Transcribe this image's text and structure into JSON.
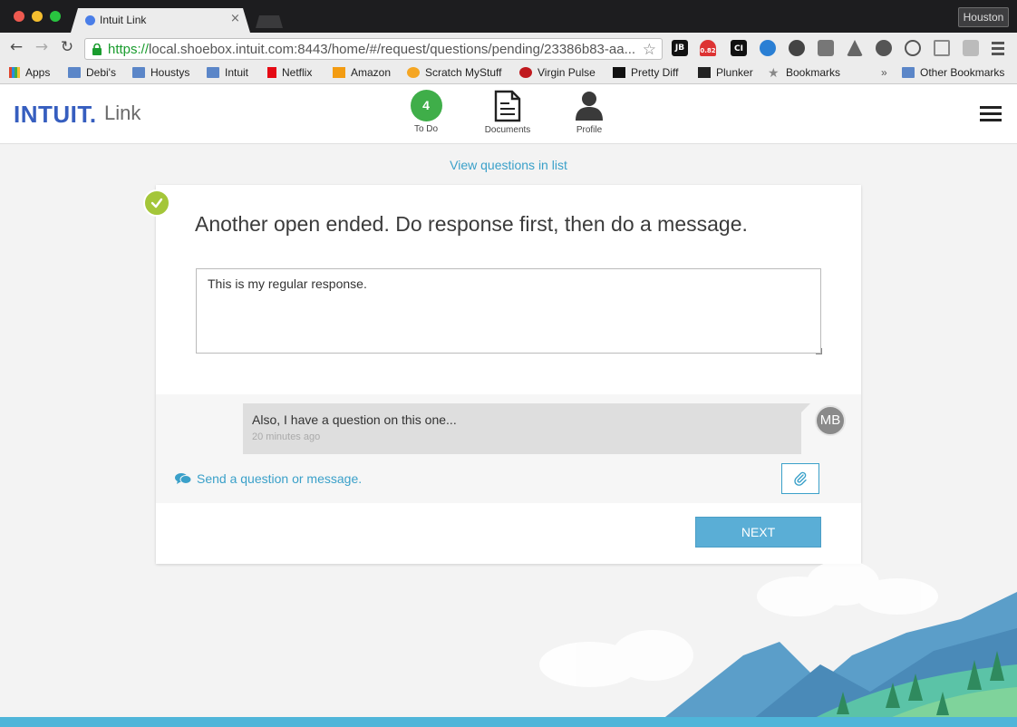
{
  "browser": {
    "tab_title": "Intuit Link",
    "tab_close": "×",
    "profile_name": "Houston",
    "url_scheme": "https://",
    "url_rest": "local.shoebox.intuit.com:8443/home/#/request/questions/pending/23386b83-aa...",
    "nav": {
      "back": "←",
      "forward": "→",
      "reload": "↻"
    },
    "star": "☆",
    "extensions": [
      "JB",
      "0.82",
      "CI"
    ],
    "bookmarks": [
      "Apps",
      "Debi's",
      "Houstys",
      "Intuit",
      "Netflix",
      "Amazon",
      "Scratch MyStuff",
      "Virgin Pulse",
      "Pretty Diff",
      "Plunker",
      "Bookmarks"
    ],
    "bookmarks_overflow": "»",
    "other_bookmarks": "Other Bookmarks"
  },
  "header": {
    "logo": "INTUIT.",
    "product": "Link",
    "nav": {
      "todo_count": "4",
      "todo_label": "To Do",
      "documents_label": "Documents",
      "profile_label": "Profile"
    }
  },
  "main": {
    "view_list_link": "View questions in list",
    "question": "Another open ended. Do response first, then do a message.",
    "response_value": "This is my regular response.",
    "message": {
      "text": "Also, I have a question on this one...",
      "time": "20 minutes ago",
      "author_initials": "MB"
    },
    "send_message_link": "Send a question or message.",
    "next_button": "NEXT"
  },
  "colors": {
    "brand_blue": "#365ebf",
    "link_blue": "#3aa0c9",
    "todo_green": "#3fae49",
    "check_green": "#a4c639",
    "next_button": "#5aaed6"
  }
}
